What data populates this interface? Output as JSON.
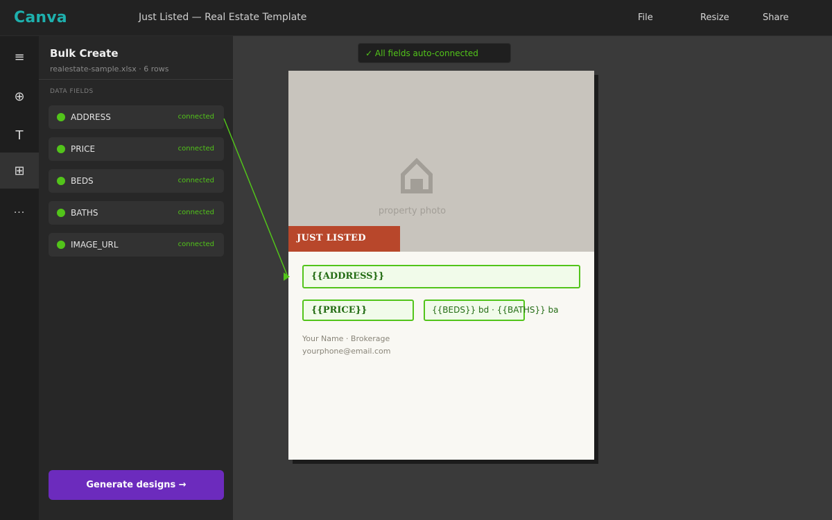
{
  "header": {
    "logo": "Canva",
    "doc_title": "Just Listed — Real Estate Template",
    "menu": {
      "file": "File",
      "resize": "Resize",
      "share": "Share"
    }
  },
  "rail": {
    "items": [
      {
        "icon": "menu-icon",
        "glyph": "≡"
      },
      {
        "icon": "add-circle-icon",
        "glyph": "⊕"
      },
      {
        "icon": "text-icon",
        "glyph": "T"
      },
      {
        "icon": "bulk-create-grid-icon",
        "glyph": "⊞",
        "active": true
      },
      {
        "icon": "more-icon",
        "glyph": "···"
      }
    ]
  },
  "panel": {
    "title": "Bulk Create",
    "subtitle": "realestate-sample.xlsx · 6 rows",
    "section_label": "DATA FIELDS",
    "fields": [
      {
        "name": "ADDRESS",
        "status": "connected"
      },
      {
        "name": "PRICE",
        "status": "connected"
      },
      {
        "name": "BEDS",
        "status": "connected"
      },
      {
        "name": "BATHS",
        "status": "connected"
      },
      {
        "name": "IMAGE_URL",
        "status": "connected"
      }
    ],
    "generate_label": "Generate designs →"
  },
  "canvas": {
    "toast": "✓ All fields auto-connected",
    "photo_label": "property photo",
    "banner": "JUST LISTED",
    "placeholders": {
      "address": "{{ADDRESS}}",
      "price": "{{PRICE}}",
      "beds_baths": "{{BEDS}} bd · {{BATHS}} ba"
    },
    "agent_name": "Your Name · Brokerage",
    "agent_contact": "yourphone@email.com"
  },
  "colors": {
    "accent_logo": "#1eb0ad",
    "connected": "#52c41a",
    "generate_button": "#6c2bbd",
    "banner": "#b8472b"
  }
}
